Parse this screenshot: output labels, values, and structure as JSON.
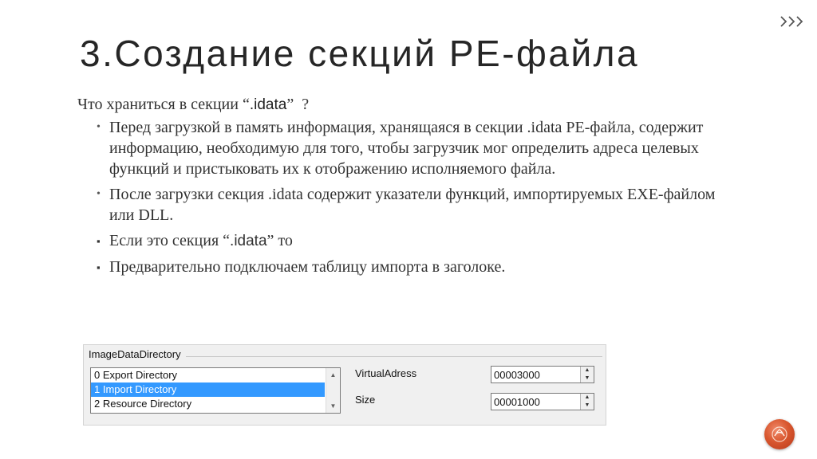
{
  "slide": {
    "title": "3.Создание секций PE-файла",
    "lead_prefix": "Что храниться в секции “",
    "lead_code": ".idata",
    "lead_suffix": "”  ?",
    "bullets": [
      {
        "text": "Перед загрузкой в память информация, хранящаяся в секции .idata PE-файла, содержит информацию, необходимую для того, чтобы загрузчик мог определить адреса целевых функций и пристыковать их к отображению исполняемого файла."
      },
      {
        "text": "После загрузки секция .idata содержит указатели функций, импортируемых EXE-файлом или DLL."
      }
    ],
    "bullet3": {
      "prefix": "Если это секция “",
      "code": ".idata",
      "suffix": "” то"
    },
    "bullet4": {
      "text": "Предварительно подключаем таблицу импорта в заголоке."
    }
  },
  "markers": {
    "round": "•",
    "square": "▪"
  },
  "dialog": {
    "group_label": "ImageDataDirectory",
    "list_items": [
      {
        "label": "0  Export Directory",
        "selected": false
      },
      {
        "label": "1  Import Directory",
        "selected": true
      },
      {
        "label": "2  Resource Directory",
        "selected": false
      }
    ],
    "virtual_address_label": "VirtualAdress",
    "virtual_address_value": "00003000",
    "size_label": "Size",
    "size_value": "00001000"
  },
  "colors": {
    "accent": "#d9572f",
    "selection": "#3399ff",
    "chevron": "#555555"
  }
}
